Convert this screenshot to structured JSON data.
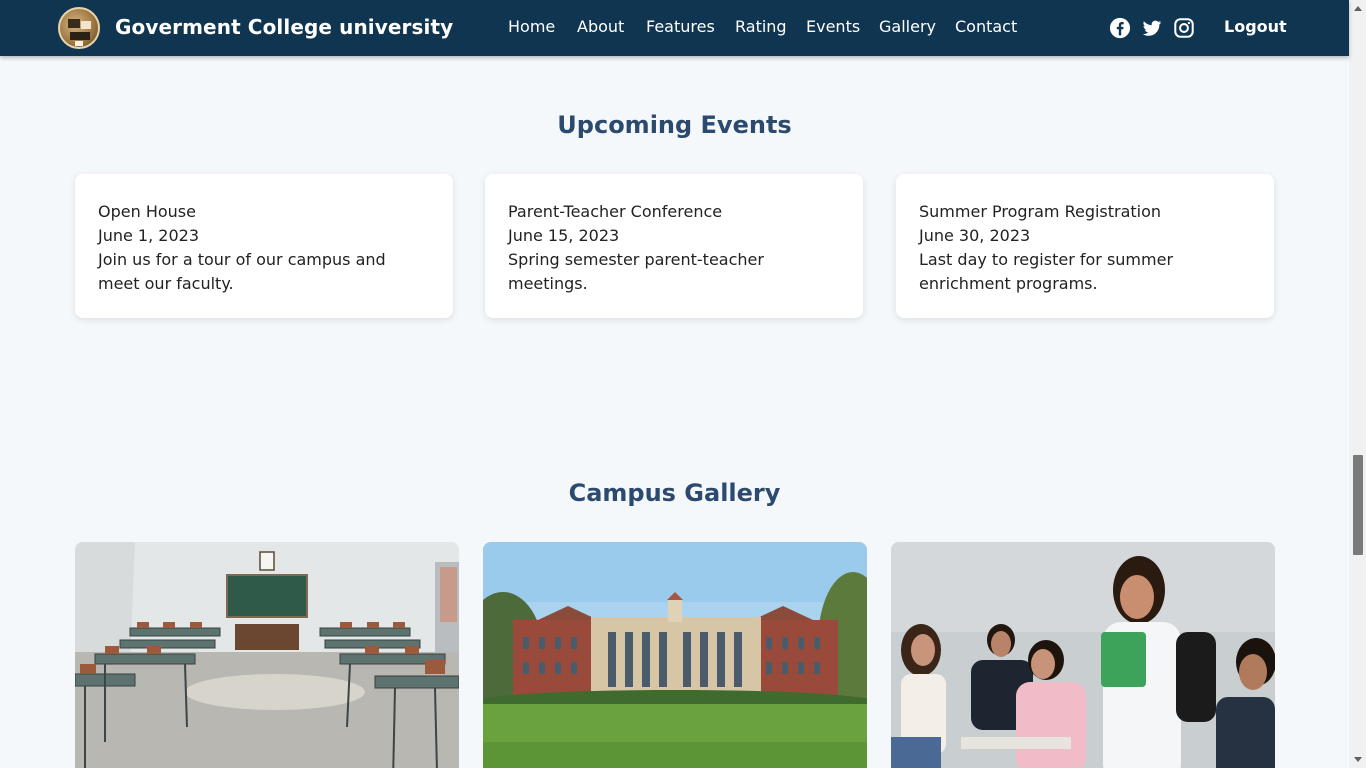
{
  "header": {
    "brand": "Goverment College university",
    "nav": [
      "Home",
      "About",
      "Features",
      "Rating",
      "Events",
      "Gallery",
      "Contact"
    ],
    "social_icons": [
      "facebook-icon",
      "twitter-icon",
      "instagram-icon"
    ],
    "logout": "Logout"
  },
  "events": {
    "title": "Upcoming Events",
    "items": [
      {
        "name": "Open House",
        "date": "June 1, 2023",
        "description": "Join us for a tour of our campus and meet our faculty."
      },
      {
        "name": "Parent-Teacher Conference",
        "date": "June 15, 2023",
        "description": "Spring semester parent-teacher meetings."
      },
      {
        "name": "Summer Program Registration",
        "date": "June 30, 2023",
        "description": "Last day to register for summer enrichment programs."
      }
    ]
  },
  "gallery": {
    "title": "Campus Gallery",
    "images": [
      "classroom-photo",
      "campus-building-photo",
      "students-photo"
    ]
  },
  "colors": {
    "navbar": "#0f3550",
    "heading": "#2c4a6e",
    "background": "#f4f8fb"
  }
}
